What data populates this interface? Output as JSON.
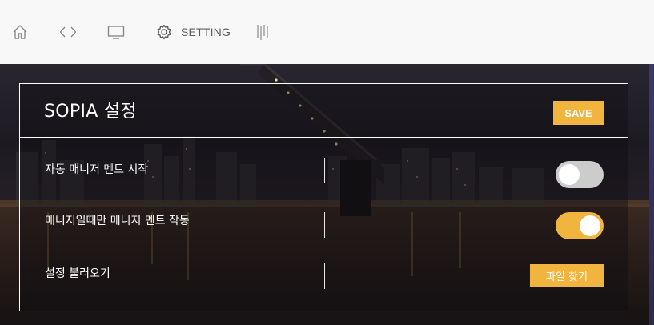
{
  "toolbar": {
    "items": [
      {
        "icon": "home-icon"
      },
      {
        "icon": "code-icon"
      },
      {
        "icon": "monitor-icon"
      },
      {
        "icon": "gear-icon",
        "label": "SETTING"
      },
      {
        "icon": "bars-icon"
      }
    ]
  },
  "panel": {
    "title": "SOPIA 설정",
    "save_label": "SAVE",
    "rows": [
      {
        "label": "자동 매니저 멘트 시작",
        "control": "toggle",
        "checked": false
      },
      {
        "label": "매니저일때만 매니저 멘트 작동",
        "control": "toggle",
        "checked": true
      },
      {
        "label": "설정 불러오기",
        "control": "button",
        "button_label": "파일 찾기"
      }
    ]
  },
  "colors": {
    "accent": "#f1b53f",
    "toggle_off": "#cccccc",
    "panel_border": "#ffffff",
    "toolbar_bg": "#f8f8f8"
  }
}
